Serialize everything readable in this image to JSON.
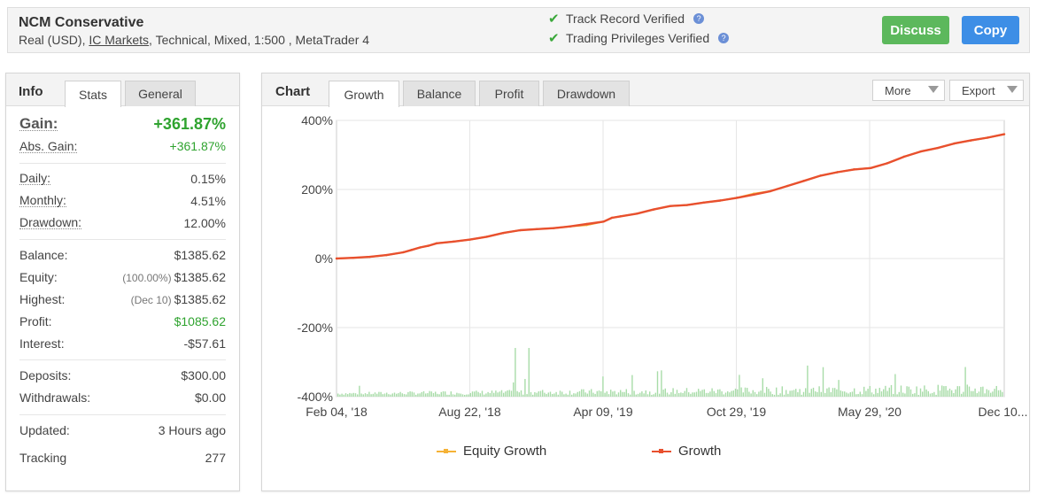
{
  "header": {
    "account_name": "NCM Conservative",
    "desc_prefix": "Real (USD), ",
    "broker": "IC Markets",
    "desc_suffix": ", Technical, Mixed, 1:500 , MetaTrader 4",
    "track_record": "Track Record Verified",
    "trading_privileges": "Trading Privileges Verified",
    "discuss_label": "Discuss",
    "copy_label": "Copy"
  },
  "left": {
    "tab_info": "Info",
    "tab_stats": "Stats",
    "tab_general": "General",
    "gain_label": "Gain:",
    "gain_value": "+361.87%",
    "abs_gain_label": "Abs. Gain:",
    "abs_gain_value": "+361.87%",
    "daily_label": "Daily:",
    "daily_value": "0.15%",
    "monthly_label": "Monthly:",
    "monthly_value": "4.51%",
    "drawdown_label": "Drawdown:",
    "drawdown_value": "12.00%",
    "balance_label": "Balance:",
    "balance_value": "$1385.62",
    "equity_label": "Equity:",
    "equity_sub": "(100.00%)",
    "equity_value": "$1385.62",
    "highest_label": "Highest:",
    "highest_sub": "(Dec 10)",
    "highest_value": "$1385.62",
    "profit_label": "Profit:",
    "profit_value": "$1085.62",
    "interest_label": "Interest:",
    "interest_value": "-$57.61",
    "deposits_label": "Deposits:",
    "deposits_value": "$300.00",
    "withdrawals_label": "Withdrawals:",
    "withdrawals_value": "$0.00",
    "updated_label": "Updated:",
    "updated_value": "3 Hours ago",
    "tracking_label": "Tracking",
    "tracking_value": "277"
  },
  "right": {
    "tab_chart": "Chart",
    "tab_growth": "Growth",
    "tab_balance": "Balance",
    "tab_profit": "Profit",
    "tab_drawdown": "Drawdown",
    "more_label": "More",
    "export_label": "Export"
  },
  "colors": {
    "growth_line": "#e8502e",
    "equity_line": "#f5b236",
    "volume_bars": "#a8dca8",
    "positive": "#2fa32f"
  },
  "chart_data": {
    "type": "line",
    "ylim": [
      -400,
      400
    ],
    "y_ticks": [
      "400%",
      "200%",
      "0%",
      "-200%",
      "-400%"
    ],
    "x_ticks": [
      "Feb 04, '18",
      "Aug 22, '18",
      "Apr 09, '19",
      "Oct 29, '19",
      "May 29, '20",
      "Dec 10..."
    ],
    "legend": [
      "Equity Growth",
      "Growth"
    ],
    "x_index": [
      0,
      10,
      20,
      30,
      40,
      45,
      50,
      55,
      60,
      70,
      80,
      90,
      100,
      110,
      120,
      130,
      140,
      150,
      160,
      165,
      170,
      180,
      190,
      200,
      210,
      220,
      230,
      240,
      250,
      260,
      270,
      280,
      290,
      300,
      310,
      320,
      330,
      340,
      350,
      360,
      370,
      380,
      390,
      400
    ],
    "series": [
      {
        "name": "Growth",
        "values": [
          0,
          2,
          5,
          10,
          18,
          25,
          32,
          37,
          44,
          49,
          55,
          63,
          74,
          82,
          85,
          88,
          93,
          100,
          107,
          118,
          122,
          130,
          142,
          152,
          155,
          162,
          168,
          176,
          185,
          195,
          210,
          225,
          240,
          250,
          258,
          262,
          276,
          295,
          310,
          320,
          333,
          342,
          350,
          360
        ]
      },
      {
        "name": "Equity Growth",
        "values": [
          0,
          2,
          5,
          10,
          18,
          25,
          32,
          37,
          44,
          49,
          55,
          63,
          74,
          82,
          85,
          88,
          93,
          97,
          107,
          118,
          122,
          130,
          142,
          152,
          155,
          162,
          168,
          176,
          188,
          195,
          210,
          225,
          240,
          250,
          258,
          262,
          276,
          295,
          310,
          320,
          333,
          342,
          350,
          360
        ]
      }
    ]
  }
}
